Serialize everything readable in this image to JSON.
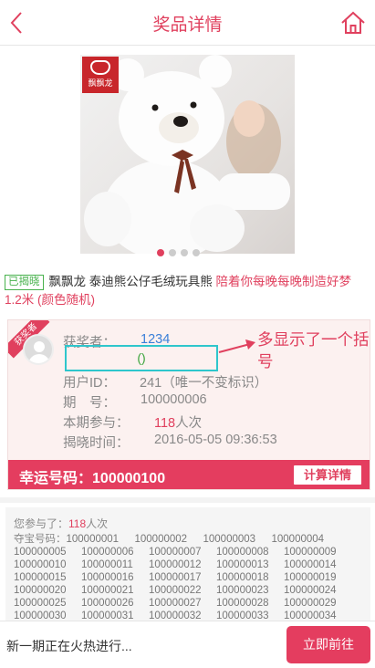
{
  "header": {
    "title": "奖品详情"
  },
  "product": {
    "logo_text": "飘飘龙",
    "carousel": {
      "count": 4,
      "active_index": 0
    },
    "status_tag": "已揭晓",
    "title": "飘飘龙 泰迪熊公仔毛绒玩具熊",
    "title_highlight": "陪着你每晚每晚制造好梦",
    "title_suffix": "1.2米 (颜色随机)"
  },
  "winner": {
    "ribbon": "获奖者",
    "name_label": "获奖者：",
    "name_value": "1234",
    "paren_text": "()",
    "user_id_label": "用户ID：",
    "user_id_value": "241（唯一不变标识）",
    "period_label": "期　号：",
    "period_value": "100000006",
    "participation_label": "本期参与：",
    "participation_count": "118",
    "participation_unit": "人次",
    "reveal_label": "揭晓时间：",
    "reveal_time": "2016-05-05 09:36:53",
    "lucky_label": "幸运号码：",
    "lucky_number": "100000100",
    "calc_button": "计算详情"
  },
  "annotation": {
    "text": "多显示了一个括号"
  },
  "participation": {
    "prefix": "您参与了：",
    "count": "118",
    "suffix": "人次",
    "codes_label": "夺宝号码：",
    "codes": [
      "100000001",
      "100000002",
      "100000003",
      "100000004",
      "100000005",
      "100000006",
      "100000007",
      "100000008",
      "100000009",
      "100000010",
      "100000011",
      "100000012",
      "100000013",
      "100000014",
      "100000015",
      "100000016",
      "100000017",
      "100000018",
      "100000019",
      "100000020",
      "100000021",
      "100000022",
      "100000023",
      "100000024",
      "100000025",
      "100000026",
      "100000027",
      "100000028",
      "100000029",
      "100000030",
      "100000031",
      "100000032",
      "100000033",
      "100000034"
    ]
  },
  "bottom": {
    "text": "新一期正在火热进行...",
    "button": "立即前往"
  },
  "colors": {
    "accent": "#e0405e",
    "bar": "#e43d5f",
    "highlight_box": "#2ec6cc",
    "tag_green": "#49b24e",
    "link_blue": "#3a7fd8"
  }
}
